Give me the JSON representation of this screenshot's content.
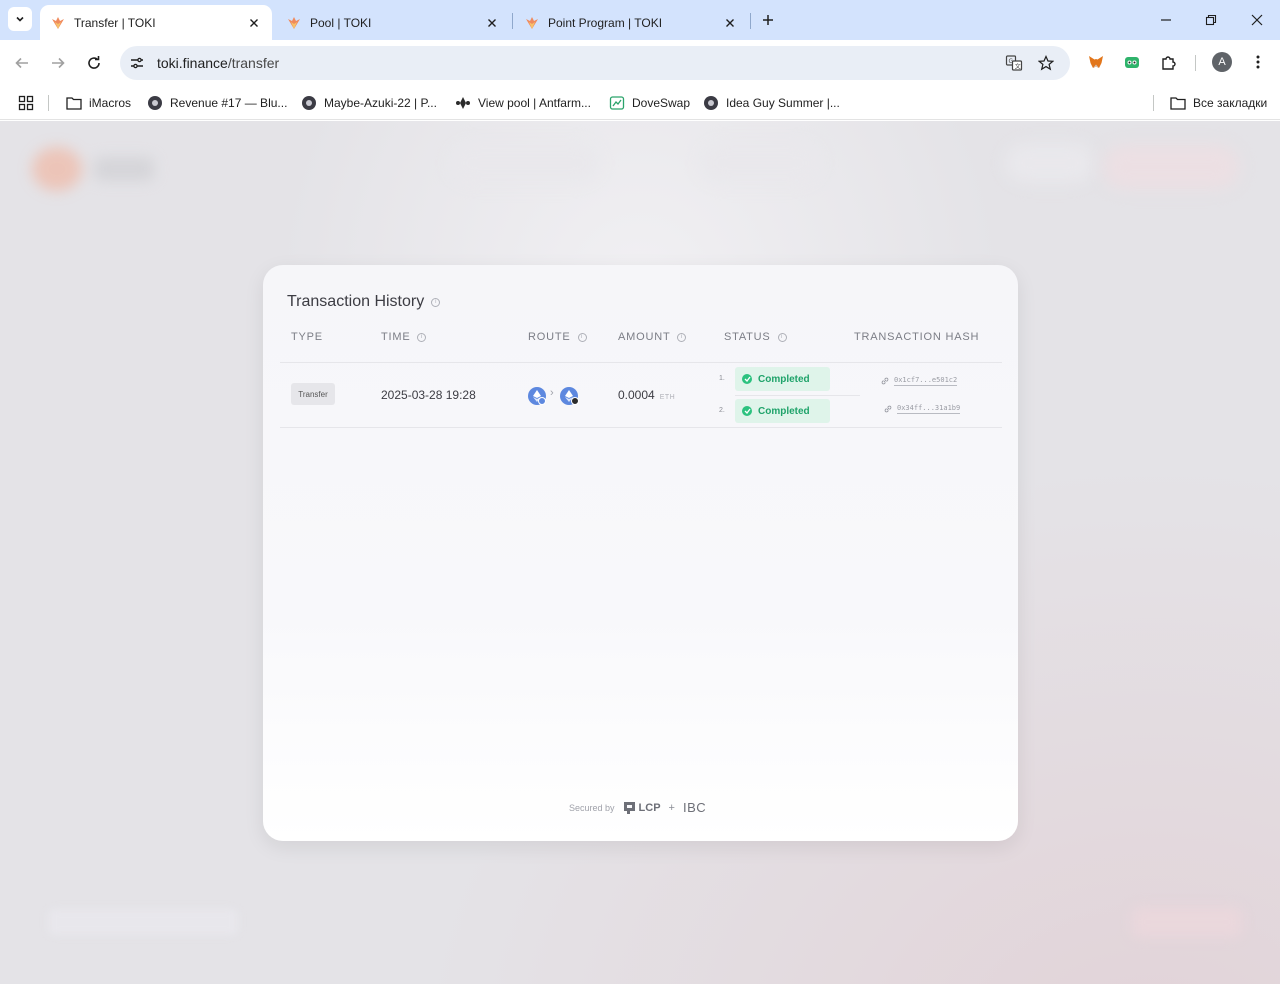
{
  "browser": {
    "tabs": [
      {
        "title": "Transfer | TOKI",
        "active": true
      },
      {
        "title": "Pool | TOKI",
        "active": false
      },
      {
        "title": "Point Program | TOKI",
        "active": false
      }
    ],
    "url_host": "toki.finance",
    "url_path": "/transfer",
    "profile_initial": "A",
    "bookmarks": [
      {
        "label": "iMacros",
        "icon": "folder-icon"
      },
      {
        "label": "Revenue #17 — Blu...",
        "icon": "site-icon"
      },
      {
        "label": "Maybe-Azuki-22 | P...",
        "icon": "site-icon"
      },
      {
        "label": "View pool | Antfarm...",
        "icon": "site-icon"
      },
      {
        "label": "DoveSwap",
        "icon": "site-icon"
      },
      {
        "label": "Idea Guy Summer |...",
        "icon": "site-icon"
      }
    ],
    "all_bookmarks": "Все закладки"
  },
  "history": {
    "title": "Transaction History",
    "columns": {
      "type": "TYPE",
      "time": "TIME",
      "route": "ROUTE",
      "amount": "AMOUNT",
      "status": "STATUS",
      "hash": "TRANSACTION HASH"
    },
    "rows": [
      {
        "type": "Transfer",
        "time": "2025-03-28 19:28",
        "amount": "0.0004",
        "unit": "ETH",
        "steps": [
          {
            "num": "1.",
            "status": "Completed",
            "hash": "0x1cf7...e501c2"
          },
          {
            "num": "2.",
            "status": "Completed",
            "hash": "0x34ff...31a1b9"
          }
        ]
      }
    ]
  },
  "footer": {
    "secured_by": "Secured by",
    "lcp": "LCP",
    "plus": "+",
    "ibc": "IBC"
  },
  "colors": {
    "accent": "#d3e3fd",
    "status_bg": "#dff4ea",
    "status_text": "#1fa36a",
    "chain": "#5d88df"
  }
}
